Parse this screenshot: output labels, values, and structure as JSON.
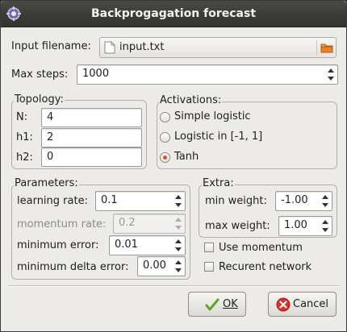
{
  "window": {
    "title": "Backprogagation forecast"
  },
  "input_file": {
    "label": "Input filename:",
    "value": "input.txt"
  },
  "max_steps": {
    "label": "Max steps:",
    "value": "1000"
  },
  "topology": {
    "title": "Topology:",
    "n_label": "N:",
    "n_value": "4",
    "h1_label": "h1:",
    "h1_value": "2",
    "h2_label": "h2:",
    "h2_value": "0"
  },
  "activations": {
    "title": "Activations:",
    "options": [
      "Simple logistic",
      "Logistic in [-1, 1]",
      "Tanh"
    ],
    "selected": "Tanh"
  },
  "parameters": {
    "title": "Parameters:",
    "learning_rate_label": "learning rate:",
    "learning_rate_value": "0.1",
    "momentum_rate_label": "momentum rate:",
    "momentum_rate_value": "0.2",
    "minimum_error_label": "minimum error:",
    "minimum_error_value": "0.01",
    "minimum_delta_error_label": "minimum delta error:",
    "minimum_delta_error_value": "0.00"
  },
  "extra": {
    "title": "Extra:",
    "min_weight_label": "min weight:",
    "min_weight_value": "-1.00",
    "max_weight_label": "max weight:",
    "max_weight_value": "1.00",
    "use_momentum_label": "Use momentum",
    "use_momentum_checked": false,
    "recurrent_label": "Recurent network",
    "recurrent_checked": false
  },
  "buttons": {
    "ok_label": "OK",
    "cancel_label": "Cancel"
  },
  "colors": {
    "titlebar": "#3a3a37",
    "radio_selected": "#e0501c",
    "ok_check": "#6ab02a",
    "cancel_icon": "#d32f2f"
  },
  "icons": [
    "app-icon",
    "file-icon",
    "open-folder-icon",
    "check-icon",
    "cancel-icon"
  ]
}
